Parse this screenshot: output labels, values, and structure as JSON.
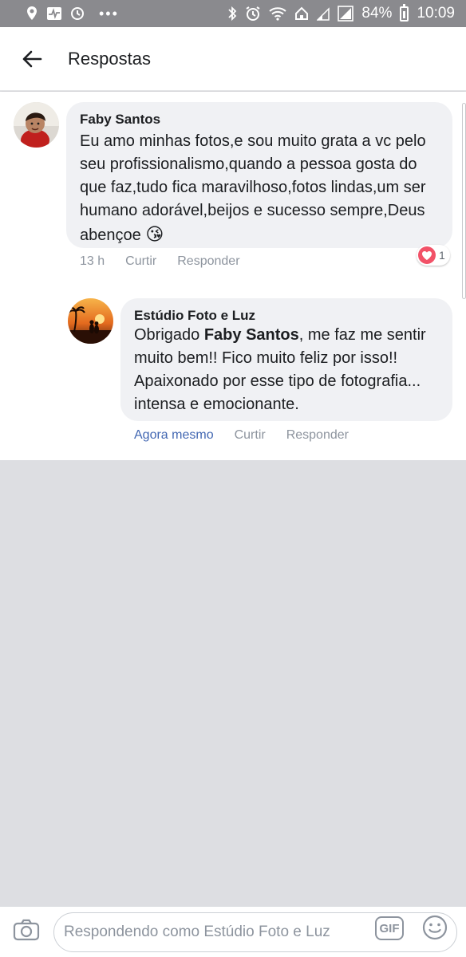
{
  "status_bar": {
    "battery": "84%",
    "time": "10:09",
    "dots": "•••"
  },
  "header": {
    "title": "Respostas"
  },
  "comments": [
    {
      "author": "Faby Santos",
      "text_lines": [
        "Eu amo minhas fotos,e sou muito grata a vc pelo",
        "seu profissionalismo,quando a pessoa gosta do",
        "que faz,tudo fica maravilhoso,fotos lindas,um ser",
        "humano adorável,beijos e sucesso sempre,Deus",
        "abençoe"
      ],
      "emoji": "😘",
      "time": "13 h",
      "like": "Curtir",
      "reply": "Responder",
      "reaction_count": "1"
    },
    {
      "author": "Estúdio Foto e Luz",
      "mention_prefix": "Obrigado ",
      "mention": "Faby Santos",
      "mention_suffix": ", me faz me sentir",
      "text_lines": [
        "muito bem!! Fico muito feliz por isso!!",
        "Apaixonado por esse tipo de fotografia...",
        "intensa e emocionante."
      ],
      "time": "Agora mesmo",
      "like": "Curtir",
      "reply": "Responder"
    }
  ],
  "compose": {
    "placeholder": "Respondendo como Estúdio Foto e Luz",
    "gif_label": "GIF"
  }
}
